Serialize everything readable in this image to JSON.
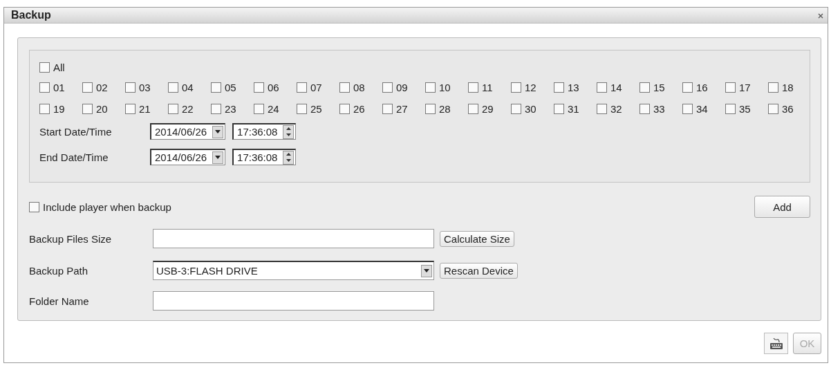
{
  "window": {
    "title": "Backup"
  },
  "all": {
    "label": "All",
    "checked": false
  },
  "channels": [
    {
      "label": "01",
      "checked": false
    },
    {
      "label": "02",
      "checked": false
    },
    {
      "label": "03",
      "checked": false
    },
    {
      "label": "04",
      "checked": false
    },
    {
      "label": "05",
      "checked": false
    },
    {
      "label": "06",
      "checked": false
    },
    {
      "label": "07",
      "checked": false
    },
    {
      "label": "08",
      "checked": false
    },
    {
      "label": "09",
      "checked": false
    },
    {
      "label": "10",
      "checked": false
    },
    {
      "label": "11",
      "checked": false
    },
    {
      "label": "12",
      "checked": false
    },
    {
      "label": "13",
      "checked": false
    },
    {
      "label": "14",
      "checked": false
    },
    {
      "label": "15",
      "checked": false
    },
    {
      "label": "16",
      "checked": false
    },
    {
      "label": "17",
      "checked": false
    },
    {
      "label": "18",
      "checked": false
    },
    {
      "label": "19",
      "checked": false
    },
    {
      "label": "20",
      "checked": false
    },
    {
      "label": "21",
      "checked": false
    },
    {
      "label": "22",
      "checked": false
    },
    {
      "label": "23",
      "checked": false
    },
    {
      "label": "24",
      "checked": false
    },
    {
      "label": "25",
      "checked": false
    },
    {
      "label": "26",
      "checked": false
    },
    {
      "label": "27",
      "checked": false
    },
    {
      "label": "28",
      "checked": false
    },
    {
      "label": "29",
      "checked": false
    },
    {
      "label": "30",
      "checked": false
    },
    {
      "label": "31",
      "checked": false
    },
    {
      "label": "32",
      "checked": false
    },
    {
      "label": "33",
      "checked": false
    },
    {
      "label": "34",
      "checked": false
    },
    {
      "label": "35",
      "checked": false
    },
    {
      "label": "36",
      "checked": false
    }
  ],
  "date_rows": [
    {
      "label": "Start Date/Time",
      "date": "2014/06/26",
      "time": "17:36:08"
    },
    {
      "label": "End Date/Time",
      "date": "2014/06/26",
      "time": "17:36:08"
    }
  ],
  "include_player": {
    "label": "Include player when backup",
    "checked": false
  },
  "add_button": "Add",
  "files_size": {
    "label": "Backup Files Size",
    "button": "Calculate Size"
  },
  "backup_path": {
    "label": "Backup Path",
    "value": "USB-3:FLASH DRIVE",
    "button": "Rescan Device"
  },
  "folder_name": {
    "label": "Folder Name"
  },
  "ok_button": {
    "label": "OK",
    "disabled": true
  }
}
